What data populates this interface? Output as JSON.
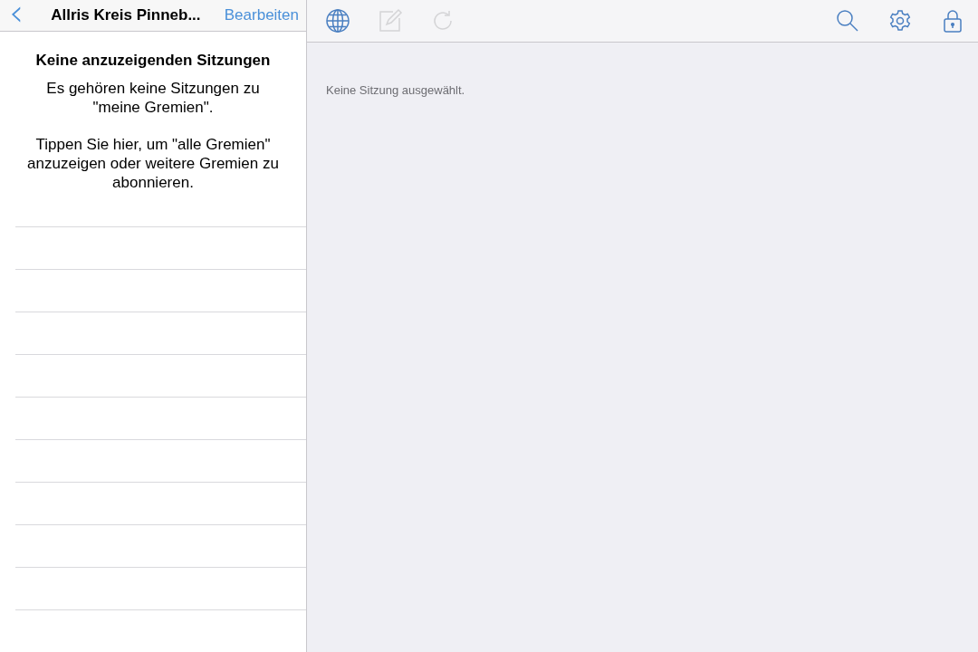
{
  "master": {
    "back_button": "‹",
    "title": "Allris Kreis Pinneb...",
    "edit_button": "Bearbeiten",
    "empty_state": {
      "title": "Keine anzuzeigenden Sitzungen",
      "paragraphs": [
        "Es gehören keine Sitzungen zu \"meine Gremien\".",
        "Tippen Sie hier, um \"alle Gremien\" anzuzeigen oder weitere Gremien zu abonnieren."
      ]
    }
  },
  "toolbar": {
    "left_tools": [
      {
        "kind": "globe",
        "disabled": false
      },
      {
        "kind": "compose",
        "disabled": true
      },
      {
        "kind": "refresh",
        "disabled": true
      }
    ],
    "right_tools": [
      {
        "kind": "search",
        "disabled": false
      },
      {
        "kind": "settings",
        "disabled": false
      },
      {
        "kind": "lock",
        "disabled": false
      }
    ]
  },
  "detail": {
    "message": "Keine Sitzung ausgewählt."
  }
}
